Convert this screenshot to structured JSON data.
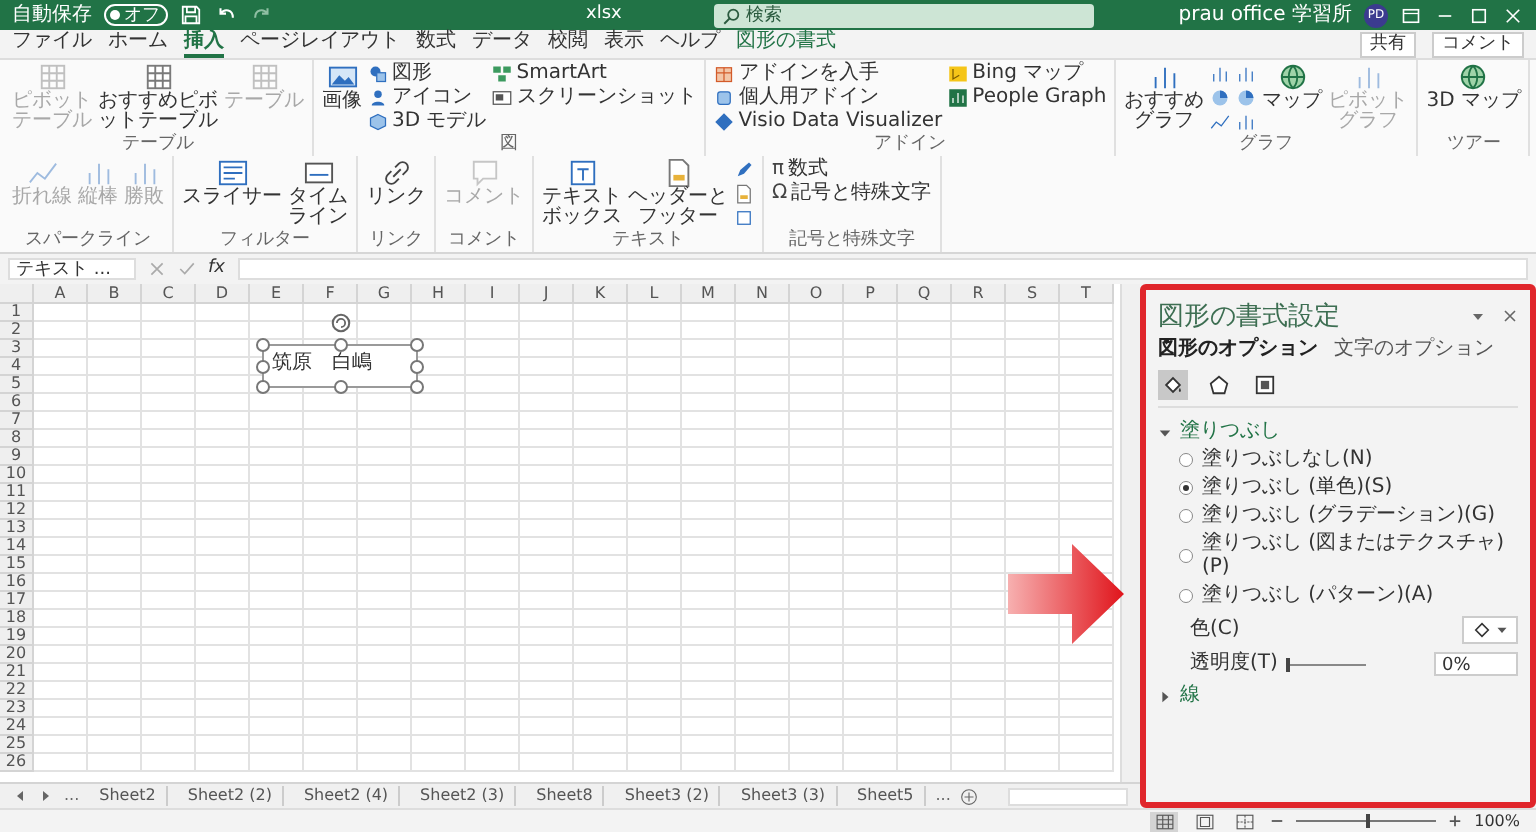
{
  "title_bar": {
    "autosave_label": "自動保存",
    "autosave_toggle": {
      "label": "オフ",
      "on": false
    },
    "file_name": "xlsx",
    "search": {
      "placeholder": "検索"
    },
    "user_name": "prau office 学習所",
    "avatar": "PD"
  },
  "menu_tabs": [
    {
      "label": "ファイル",
      "selected": false,
      "kind": "normal"
    },
    {
      "label": "ホーム",
      "selected": false,
      "kind": "normal"
    },
    {
      "label": "挿入",
      "selected": true,
      "kind": "normal"
    },
    {
      "label": "ページレイアウト",
      "selected": false,
      "kind": "normal"
    },
    {
      "label": "数式",
      "selected": false,
      "kind": "normal"
    },
    {
      "label": "データ",
      "selected": false,
      "kind": "normal"
    },
    {
      "label": "校閲",
      "selected": false,
      "kind": "normal"
    },
    {
      "label": "表示",
      "selected": false,
      "kind": "normal"
    },
    {
      "label": "ヘルプ",
      "selected": false,
      "kind": "normal"
    },
    {
      "label": "図形の書式",
      "selected": false,
      "kind": "contextual"
    }
  ],
  "share_button": "共有",
  "comment_button": "コメント",
  "ribbon_groups": [
    {
      "label": "テーブル",
      "items": [
        {
          "kind": "large",
          "label": "ピボットテーブル",
          "disabled": true
        },
        {
          "kind": "large",
          "label": "おすすめピボットテーブル",
          "disabled": false
        },
        {
          "kind": "large",
          "label": "テーブル",
          "disabled": true
        }
      ]
    },
    {
      "label": "図",
      "items": [
        {
          "kind": "large",
          "label": "画像",
          "disabled": false
        },
        {
          "kind": "small",
          "label": "図形",
          "disabled": false
        },
        {
          "kind": "small",
          "label": "アイコン",
          "disabled": false
        },
        {
          "kind": "small",
          "label": "3D モデル",
          "disabled": false
        },
        {
          "kind": "small",
          "label": "SmartArt",
          "disabled": false
        },
        {
          "kind": "small",
          "label": "スクリーンショット",
          "disabled": false
        }
      ]
    },
    {
      "label": "アドイン",
      "items": [
        {
          "kind": "small",
          "label": "アドインを入手",
          "disabled": false
        },
        {
          "kind": "small",
          "label": "個人用アドイン",
          "disabled": false
        },
        {
          "kind": "small",
          "label": "Visio Data Visualizer",
          "disabled": false
        },
        {
          "kind": "small",
          "label": "Bing マップ",
          "disabled": false
        },
        {
          "kind": "small",
          "label": "People Graph",
          "disabled": false
        }
      ]
    },
    {
      "label": "グラフ",
      "items": [
        {
          "kind": "large",
          "label": "おすすめグラフ",
          "disabled": false
        },
        {
          "kind": "icon",
          "disabled": false
        },
        {
          "kind": "icon",
          "disabled": false
        },
        {
          "kind": "icon",
          "disabled": false
        },
        {
          "kind": "icon",
          "disabled": false
        },
        {
          "kind": "icon",
          "disabled": false
        },
        {
          "kind": "icon",
          "disabled": false
        },
        {
          "kind": "large",
          "label": "マップ",
          "disabled": false
        },
        {
          "kind": "large",
          "label": "ピボットグラフ",
          "disabled": true
        }
      ]
    },
    {
      "label": "ツアー",
      "items": [
        {
          "kind": "large",
          "label": "3D マップ",
          "disabled": false
        }
      ]
    },
    {
      "label": "スパークライン",
      "items": [
        {
          "kind": "large",
          "label": "折れ線",
          "disabled": true
        },
        {
          "kind": "large",
          "label": "縦棒",
          "disabled": true
        },
        {
          "kind": "large",
          "label": "勝敗",
          "disabled": true
        }
      ]
    },
    {
      "label": "フィルター",
      "items": [
        {
          "kind": "large",
          "label": "スライサー",
          "disabled": false
        },
        {
          "kind": "large",
          "label": "タイムライン",
          "disabled": false
        }
      ]
    },
    {
      "label": "リンク",
      "items": [
        {
          "kind": "large",
          "label": "リンク",
          "disabled": false
        }
      ]
    },
    {
      "label": "コメント",
      "items": [
        {
          "kind": "large",
          "label": "コメント",
          "disabled": true
        }
      ]
    },
    {
      "label": "テキスト",
      "items": [
        {
          "kind": "large",
          "label": "テキストボックス",
          "disabled": false
        },
        {
          "kind": "large",
          "label": "ヘッダーとフッター",
          "disabled": false
        },
        {
          "kind": "icon",
          "disabled": false
        },
        {
          "kind": "icon",
          "disabled": false
        },
        {
          "kind": "icon",
          "disabled": false
        }
      ]
    },
    {
      "label": "記号と特殊文字",
      "items": [
        {
          "kind": "small",
          "glyph": "π",
          "label": "数式",
          "disabled": false
        },
        {
          "kind": "small",
          "glyph": "Ω",
          "label": "記号と特殊文字",
          "disabled": false
        }
      ]
    }
  ],
  "formula_bar": {
    "name_box": "テキスト ...",
    "function_label": "fx"
  },
  "columns": [
    "A",
    "B",
    "C",
    "D",
    "E",
    "F",
    "G",
    "H",
    "I",
    "J",
    "K",
    "L",
    "M",
    "N",
    "O",
    "P",
    "Q",
    "R",
    "S",
    "T"
  ],
  "rows": [
    "1",
    "2",
    "3",
    "4",
    "5",
    "6",
    "7",
    "8",
    "9",
    "10",
    "11",
    "12",
    "13",
    "14",
    "15",
    "16",
    "17",
    "18",
    "19",
    "20",
    "21",
    "22",
    "23",
    "24",
    "25",
    "26"
  ],
  "text_box": {
    "text": "筑原　白嶋"
  },
  "sheet_tabs": [
    {
      "label": "Sheet2",
      "selected": false
    },
    {
      "label": "Sheet2 (2)",
      "selected": false
    },
    {
      "label": "Sheet2 (4)",
      "selected": false
    },
    {
      "label": "Sheet2 (3)",
      "selected": false
    },
    {
      "label": "Sheet8",
      "selected": false
    },
    {
      "label": "Sheet3 (2)",
      "selected": false
    },
    {
      "label": "Sheet3 (3)",
      "selected": false
    },
    {
      "label": "Sheet5",
      "selected": false
    }
  ],
  "sheet_nav_more": "...",
  "format_pane": {
    "title": "図形の書式設定",
    "tabs": [
      {
        "label": "図形のオプション",
        "selected": true
      },
      {
        "label": "文字のオプション",
        "selected": false
      }
    ],
    "icon_tabs": [
      {
        "selected": true
      },
      {
        "selected": false
      },
      {
        "selected": false
      }
    ],
    "fill_section": {
      "label": "塗りつぶし",
      "expanded": true
    },
    "fill_options": [
      {
        "label": "塗りつぶしなし(N)",
        "selected": false
      },
      {
        "label": "塗りつぶし (単色)(S)",
        "selected": true
      },
      {
        "label": "塗りつぶし (グラデーション)(G)",
        "selected": false
      },
      {
        "label": "塗りつぶし (図またはテクスチャ)(P)",
        "selected": false
      },
      {
        "label": "塗りつぶし (パターン)(A)",
        "selected": false
      }
    ],
    "color": {
      "label": "色(C)"
    },
    "transparency": {
      "label": "透明度(T)",
      "level": 0,
      "value": "0%"
    },
    "line_section": {
      "label": "線",
      "expanded": false
    }
  },
  "view_buttons": [
    {
      "selected": true
    },
    {
      "selected": false
    },
    {
      "selected": false
    }
  ],
  "zoom": {
    "level": 0.5,
    "value": "100%"
  }
}
